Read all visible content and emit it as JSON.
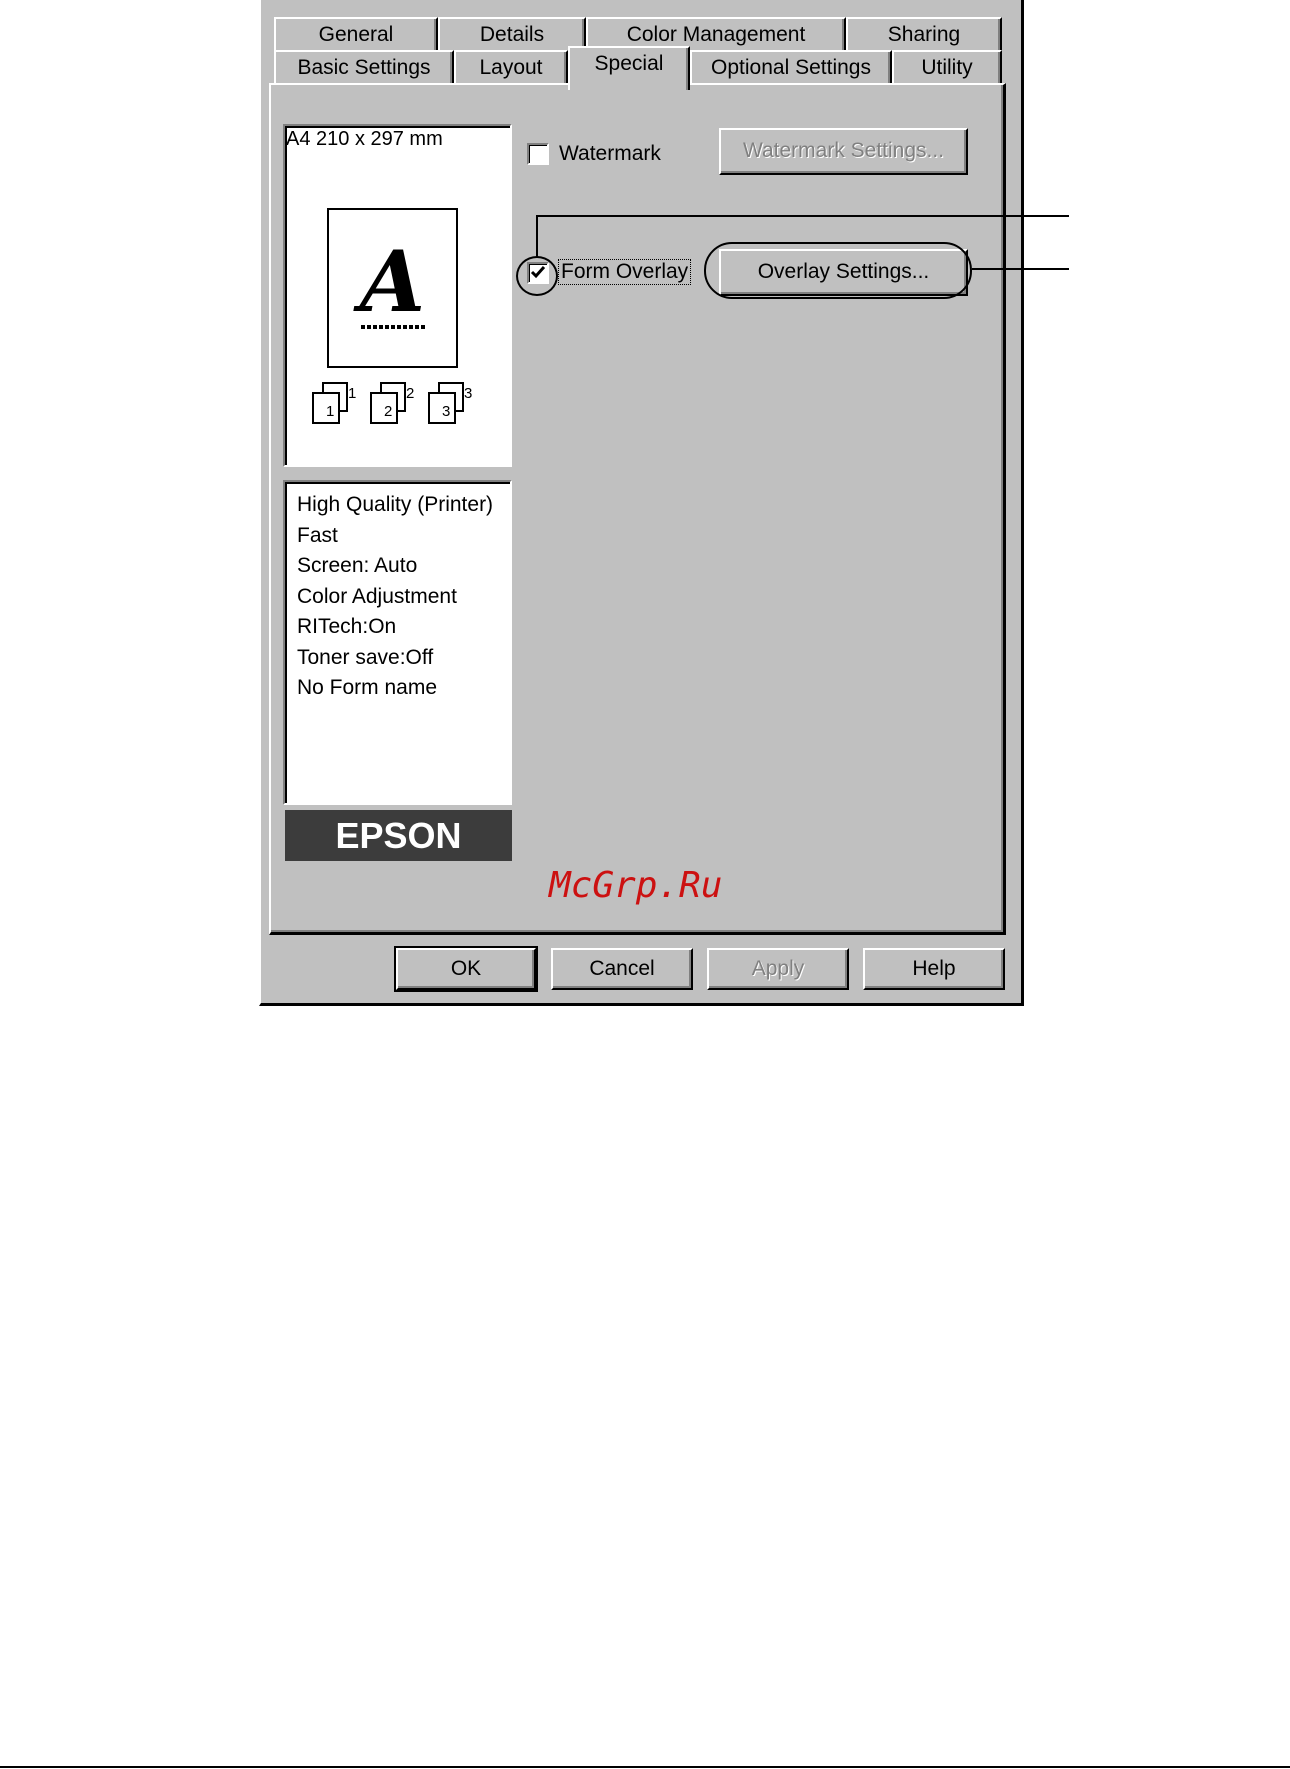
{
  "tabs_row1": [
    {
      "label": "General"
    },
    {
      "label": "Details"
    },
    {
      "label": "Color Management"
    },
    {
      "label": "Sharing"
    }
  ],
  "tabs_row2": [
    {
      "label": "Basic Settings"
    },
    {
      "label": "Layout"
    },
    {
      "label": "Special",
      "active": true
    },
    {
      "label": "Optional Settings"
    },
    {
      "label": "Utility"
    }
  ],
  "preview": {
    "paper_size": "A4 210 x 297 mm",
    "letter": "A",
    "copies": [
      {
        "num": "1",
        "sub": "1"
      },
      {
        "num": "2",
        "sub": "2"
      },
      {
        "num": "3",
        "sub": "3"
      }
    ]
  },
  "status_list": [
    "High Quality (Printer)",
    "Fast",
    "Screen: Auto",
    "Color Adjustment",
    "RITech:On",
    "Toner save:Off",
    "No Form name"
  ],
  "brand_logo": "EPSON",
  "watermark_option": {
    "label": "Watermark",
    "checked": false,
    "settings_button": "Watermark Settings...",
    "settings_enabled": false
  },
  "form_overlay_option": {
    "label": "Form Overlay",
    "checked": true,
    "settings_button": "Overlay Settings...",
    "settings_enabled": true
  },
  "footer_buttons": {
    "ok": "OK",
    "cancel": "Cancel",
    "apply": "Apply",
    "help": "Help"
  },
  "watermark_text": "McGrp.Ru",
  "colors": {
    "dialog_bg": "#c0c0c0",
    "logo_bg": "#3c3c3c",
    "watermark": "#cc1111"
  }
}
